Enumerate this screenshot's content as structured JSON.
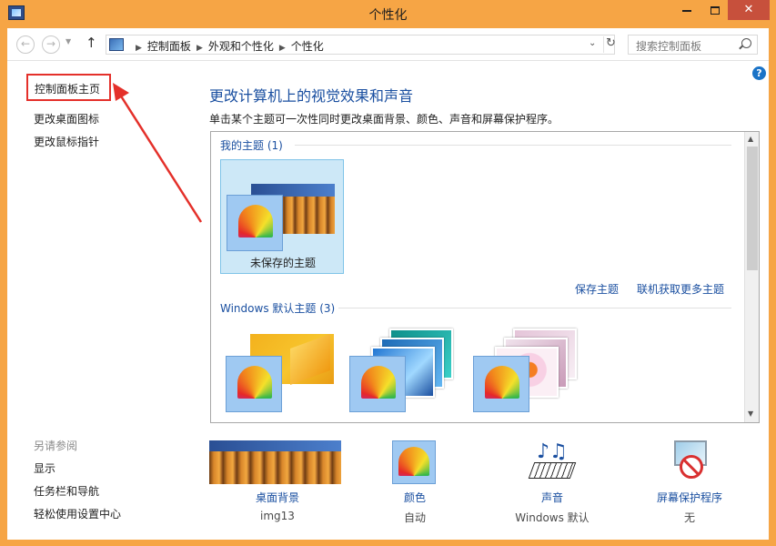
{
  "window": {
    "title": "个性化",
    "minimize_icon": "minimize-icon",
    "maximize_icon": "maximize-icon",
    "close_icon": "close-icon",
    "close_glyph": "✕"
  },
  "addressbar": {
    "back_glyph": "←",
    "forward_glyph": "→",
    "up_glyph": "↑",
    "crumbs": [
      "控制面板",
      "外观和个性化",
      "个性化"
    ],
    "refresh_glyph": "↻",
    "search_placeholder": "搜索控制面板"
  },
  "help_glyph": "?",
  "sidebar": {
    "home": "控制面板主页",
    "links": [
      "更改桌面图标",
      "更改鼠标指针"
    ],
    "see_also_label": "另请参阅",
    "see_also": [
      "显示",
      "任务栏和导航",
      "轻松使用设置中心"
    ]
  },
  "main": {
    "heading": "更改计算机上的视觉效果和声音",
    "description": "单击某个主题可一次性同时更改桌面背景、颜色、声音和屏幕保护程序。",
    "my_themes": {
      "header": "我的主题 (1)",
      "items": [
        {
          "label": "未保存的主题"
        }
      ]
    },
    "save_theme": "保存主题",
    "get_more": "联机获取更多主题",
    "windows_themes": {
      "header": "Windows 默认主题 (3)"
    }
  },
  "bottom": [
    {
      "name": "桌面背景",
      "value": "img13"
    },
    {
      "name": "颜色",
      "value": "自动"
    },
    {
      "name": "声音",
      "value": "Windows 默认"
    },
    {
      "name": "屏幕保护程序",
      "value": "无"
    }
  ],
  "colors": {
    "accent": "#1a4fa0",
    "frame": "#f6a545",
    "highlight_box": "#e4302a",
    "selection": "#cde8f7"
  }
}
